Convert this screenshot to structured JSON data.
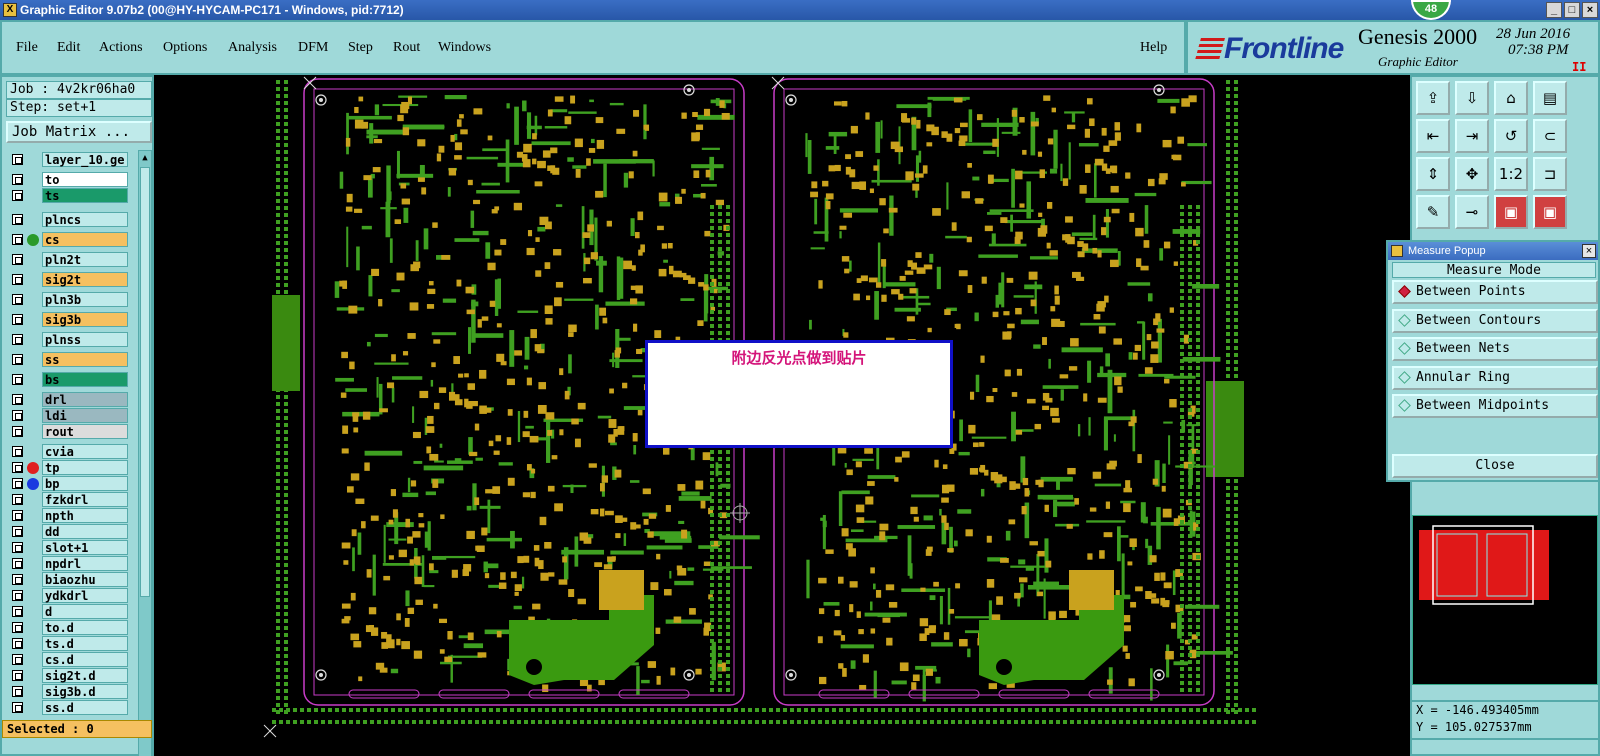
{
  "window": {
    "title": "Graphic Editor 9.07b2 (00@HY-HYCAM-PC171 - Windows, pid:7712)",
    "badge": "48"
  },
  "menu": {
    "items": [
      "File",
      "Edit",
      "Actions",
      "Options",
      "Analysis",
      "DFM",
      "Step",
      "Rout",
      "Windows"
    ],
    "help": "Help"
  },
  "brand": {
    "logo": "Frontline",
    "product": "Genesis 2000",
    "subtitle": "Graphic Editor",
    "date": "28 Jun 2016",
    "time": "07:38 PM",
    "pause": "II"
  },
  "job": {
    "job_line": "Job : 4v2kr06ha0",
    "step_line": "Step: set+1",
    "matrix_button": "Job Matrix ..."
  },
  "layers": [
    {
      "name": "layer_10.ge",
      "bg": "#bfeaea"
    },
    {
      "name": "to",
      "bg": "#ffffff"
    },
    {
      "name": "ts",
      "bg": "#1a9a6a"
    },
    {
      "name": "plncs",
      "bg": "#bfeaea"
    },
    {
      "name": "cs",
      "bg": "#f5c060",
      "dot": "#2a9a2a"
    },
    {
      "name": "pln2t",
      "bg": "#bfeaea"
    },
    {
      "name": "sig2t",
      "bg": "#f5c060"
    },
    {
      "name": "pln3b",
      "bg": "#bfeaea"
    },
    {
      "name": "sig3b",
      "bg": "#f5c060"
    },
    {
      "name": "plnss",
      "bg": "#bfeaea"
    },
    {
      "name": "ss",
      "bg": "#f5c060"
    },
    {
      "name": "bs",
      "bg": "#1a9a6a"
    },
    {
      "name": "drl",
      "bg": "#9ab8c0"
    },
    {
      "name": "ldi",
      "bg": "#9ab8c0"
    },
    {
      "name": "rout",
      "bg": "#dcdcdc"
    },
    {
      "name": "cvia",
      "bg": "#bfeaea"
    },
    {
      "name": "tp",
      "bg": "#bfeaea",
      "dot": "#e02020"
    },
    {
      "name": "bp",
      "bg": "#bfeaea",
      "dot": "#1a3ae0"
    },
    {
      "name": "fzkdrl",
      "bg": "#bfeaea"
    },
    {
      "name": "npth",
      "bg": "#bfeaea"
    },
    {
      "name": "dd",
      "bg": "#bfeaea"
    },
    {
      "name": "slot+1",
      "bg": "#bfeaea"
    },
    {
      "name": "npdrl",
      "bg": "#bfeaea"
    },
    {
      "name": "biaozhu",
      "bg": "#bfeaea"
    },
    {
      "name": "ydkdrl",
      "bg": "#bfeaea"
    },
    {
      "name": "d",
      "bg": "#bfeaea"
    },
    {
      "name": "to.d",
      "bg": "#bfeaea"
    },
    {
      "name": "ts.d",
      "bg": "#bfeaea"
    },
    {
      "name": "cs.d",
      "bg": "#bfeaea"
    },
    {
      "name": "sig2t.d",
      "bg": "#bfeaea"
    },
    {
      "name": "sig3b.d",
      "bg": "#bfeaea"
    },
    {
      "name": "ss.d",
      "bg": "#bfeaea"
    }
  ],
  "status": {
    "selected": "Selected : 0"
  },
  "notice": {
    "text": "附边反光点做到贴片"
  },
  "measure_popup": {
    "title": "Measure Popup",
    "heading": "Measure Mode",
    "options": [
      "Between Points",
      "Between Contours",
      "Between Nets",
      "Annular Ring",
      "Between Midpoints"
    ],
    "selected_index": 0,
    "close": "Close"
  },
  "coords": {
    "x": "X = -146.493405mm",
    "y": "Y = 105.027537mm"
  },
  "tools": [
    "⇪",
    "⇩",
    "⌂",
    "▤",
    "⇤",
    "⇥",
    "↺",
    "⊂",
    "⇕",
    "✥",
    "1:2",
    "⊐",
    "✎",
    "⊸",
    "▣",
    "▣"
  ],
  "colors": {
    "trace_green": "#3fa021",
    "pad_yellow": "#c9a21e",
    "outline_magenta": "#c83cc8",
    "panel_teal": "#9fd9d9"
  }
}
